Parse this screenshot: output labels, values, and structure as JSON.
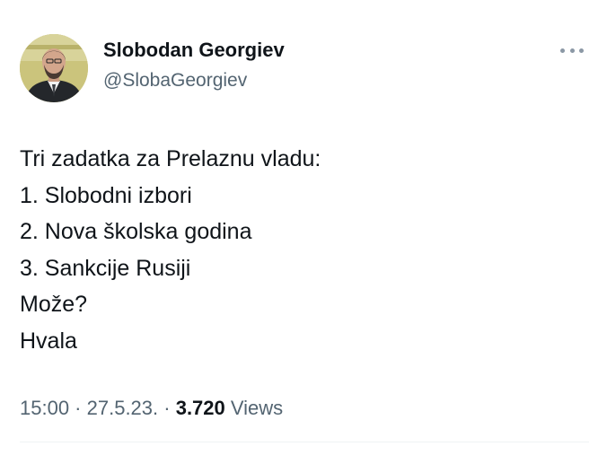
{
  "author": {
    "display_name": "Slobodan Georgiev",
    "handle": "@SlobaGeorgiev"
  },
  "tweet": {
    "lines": [
      "Tri zadatka za Prelaznu vladu:",
      "1. Slobodni izbori",
      "2. Nova školska godina",
      "3. Sankcije Rusiji",
      "Može?",
      "Hvala"
    ]
  },
  "meta": {
    "time": "15:00",
    "separator": " · ",
    "date": "27.5.23.",
    "views_count": "3.720",
    "views_label": "Views"
  },
  "icons": {
    "more": "more-horizontal-icon"
  },
  "colors": {
    "text_primary": "#0f1419",
    "text_secondary": "#536471",
    "divider": "#eff3f4",
    "avatar_background": "#c9c27a"
  }
}
